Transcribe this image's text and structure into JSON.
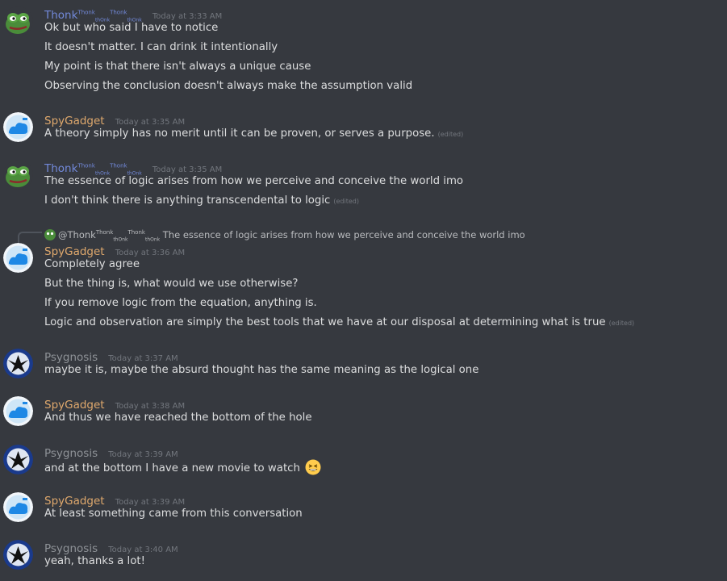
{
  "colors": {
    "background": "#36393f",
    "thonk": "#7289da",
    "spygadget": "#e0a96d",
    "psygnosis": "#8e9297",
    "text": "#dcddde",
    "timestamp": "#72767d"
  },
  "messages": [
    {
      "author": "Thonk",
      "author_tag_1": "Thonk",
      "author_tag_1_sub": "thOnk",
      "author_tag_2": "Thonk",
      "author_tag_2_sub": "thOnk",
      "timestamp": "Today at 3:33 AM",
      "avatar_icon": "pepe-frog-icon",
      "lines": [
        "Ok but who said I have to notice",
        "It doesn't matter. I can drink it intentionally",
        "My point is that there isn't always a unique cause",
        "Observing the conclusion doesn't always make the assumption valid"
      ]
    },
    {
      "author": "SpyGadget",
      "timestamp": "Today at 3:35 AM",
      "avatar_icon": "blue-cloud-icon",
      "lines": [
        "A theory simply has no merit until it can be proven, or serves a purpose."
      ],
      "edited": "(edited)"
    },
    {
      "author": "Thonk",
      "author_tag_1": "Thonk",
      "author_tag_1_sub": "thOnk",
      "author_tag_2": "Thonk",
      "author_tag_2_sub": "thOnk",
      "timestamp": "Today at 3:35 AM",
      "avatar_icon": "pepe-frog-icon",
      "lines": [
        "The essence of logic arises from how we perceive and conceive the world imo",
        "I don't think there is anything transcendental to logic"
      ],
      "edited": "(edited)"
    },
    {
      "reply": {
        "mention": "@Thonk",
        "tag_1": "Thonk",
        "tag_1_sub": "thOnk",
        "tag_2": "Thonk",
        "tag_2_sub": "thOnk",
        "text": "The essence of logic arises from how we perceive and conceive the world imo"
      },
      "author": "SpyGadget",
      "timestamp": "Today at 3:36 AM",
      "avatar_icon": "blue-cloud-icon",
      "lines": [
        "Completely agree",
        "But the thing is, what would we use otherwise?",
        "If you remove logic from the equation, anything is.",
        "Logic and observation are simply the best tools that we have at our disposal at determining what is true"
      ],
      "edited": "(edited)"
    },
    {
      "author": "Psygnosis",
      "timestamp": "Today at 3:37 AM",
      "avatar_icon": "raven-icon",
      "lines": [
        "maybe it is, maybe the absurd thought has the same meaning as the logical one"
      ]
    },
    {
      "author": "SpyGadget",
      "timestamp": "Today at 3:38 AM",
      "avatar_icon": "blue-cloud-icon",
      "lines": [
        "And thus we have reached the bottom of the hole"
      ]
    },
    {
      "author": "Psygnosis",
      "timestamp": "Today at 3:39 AM",
      "avatar_icon": "raven-icon",
      "lines": [
        "and at the bottom I have a new movie to watch"
      ],
      "emoji": "grinning-squinting-face-emoji"
    },
    {
      "author": "SpyGadget",
      "timestamp": "Today at 3:39 AM",
      "avatar_icon": "blue-cloud-icon",
      "lines": [
        "At least something came from this conversation"
      ]
    },
    {
      "author": "Psygnosis",
      "timestamp": "Today at 3:40 AM",
      "avatar_icon": "raven-icon",
      "lines": [
        "yeah, thanks a lot!"
      ]
    }
  ]
}
